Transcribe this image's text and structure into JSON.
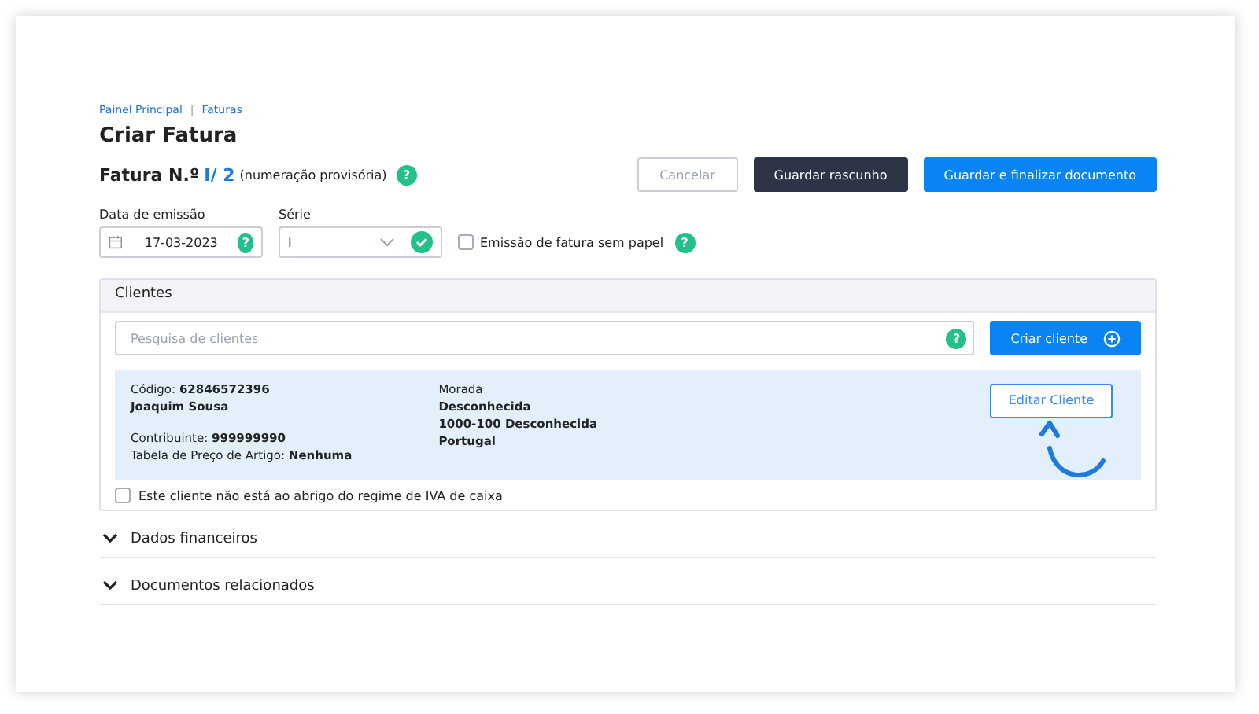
{
  "breadcrumb": [
    "Painel Principal",
    "Faturas"
  ],
  "breadcrumb_separator": "|",
  "title": "Criar Fatura",
  "invoice": {
    "label": "Fatura N.º",
    "number": "I/ 2",
    "note": "(numeração provisória)",
    "help": "?"
  },
  "buttons": [
    {
      "label": "Cancelar",
      "kind": "outline"
    },
    {
      "label": "Guardar rascunho",
      "kind": "dark"
    },
    {
      "label": "Guardar e finalizar documento",
      "kind": "primary"
    }
  ],
  "date": {
    "label": "Data de emissão",
    "value": "17-03-2023",
    "help": "?"
  },
  "series": {
    "label": "Série",
    "value": "I"
  },
  "paperless": {
    "label": "Emissão de fatura sem papel",
    "checked": false,
    "help": "?"
  },
  "clients": {
    "title": "Clientes",
    "search": {
      "placeholder": "Pesquisa de clientes",
      "help": "?"
    },
    "create_button": "Criar cliente",
    "card": {
      "left": [
        "Código: **62846572396**",
        "**Joaquim Sousa**",
        "Contribuinte: **999999990**",
        "Tabela de Preço de Artigo: **Nenhuma**"
      ],
      "address_label": "Morada",
      "address": [
        "Desconhecida",
        "1000-100 Desconhecida",
        "Portugal"
      ],
      "edit_button": "Editar Cliente"
    },
    "vat_checkbox": {
      "label": "Este cliente não está ao abrigo do regime de IVA de caixa",
      "checked": false
    }
  },
  "sections": [
    {
      "label": "Dados financeiros",
      "expanded": false
    },
    {
      "label": "Documentos relacionados",
      "expanded": false
    }
  ]
}
